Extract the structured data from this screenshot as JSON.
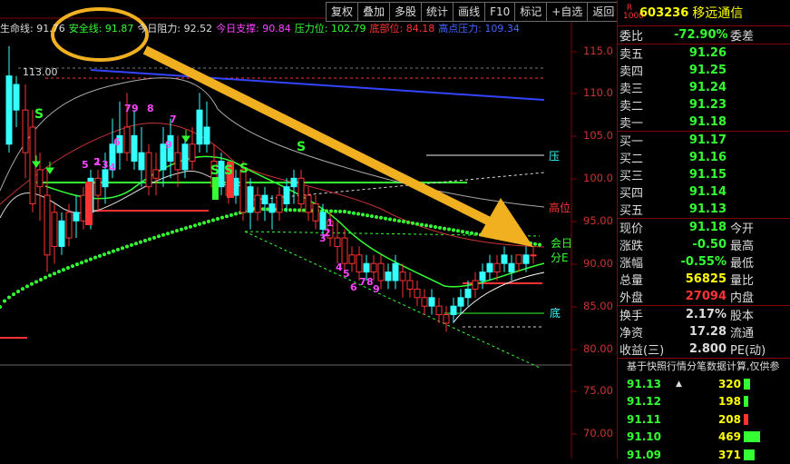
{
  "toolbar": [
    "复权",
    "叠加",
    "多股",
    "统计",
    "画线",
    "F10",
    "标记",
    "+自选",
    "返回"
  ],
  "indicators": [
    {
      "text": "生命线: 91.76",
      "color": "#dddddd"
    },
    {
      "text": "安全线: 91.87",
      "color": "#33ff33"
    },
    {
      "text": "今日阻力: 92.52",
      "color": "#dddddd"
    },
    {
      "text": "今日支撑: 90.84",
      "color": "#ff44ff"
    },
    {
      "text": "压力位: 102.79",
      "color": "#33ff33"
    },
    {
      "text": "底部位: 84.18",
      "color": "#ff3333"
    },
    {
      "text": "高点压力: 109.34",
      "color": "#4466ff"
    }
  ],
  "price_axis": [
    "115.0",
    "110.0",
    "105.0",
    "100.0",
    "95.00",
    "90.00",
    "85.00",
    "80.00",
    "75.00",
    "70.00"
  ],
  "chart_labels": {
    "high_marker": "113.00",
    "pressure": "压",
    "high_pos": "高位",
    "balance_1": "会日",
    "balance_2": "分E",
    "bottom": "底"
  },
  "chart_marks": [
    "S",
    "S",
    "S",
    "S",
    "S",
    "5",
    "6",
    "1",
    "2",
    "3",
    "4",
    "7",
    "9",
    "8",
    "7",
    "9",
    "3",
    "2",
    "1",
    "4",
    "5",
    "6",
    "7",
    "8",
    "9"
  ],
  "stock": {
    "logo": "R 1000",
    "code": "603236",
    "name": "移远通信"
  },
  "weibi": {
    "label": "委比",
    "value": "-72.90%",
    "label2": "委差"
  },
  "asks": [
    {
      "label": "卖五",
      "price": "91.26"
    },
    {
      "label": "卖四",
      "price": "91.25"
    },
    {
      "label": "卖三",
      "price": "91.24"
    },
    {
      "label": "卖二",
      "price": "91.23"
    },
    {
      "label": "卖一",
      "price": "91.18"
    }
  ],
  "bids": [
    {
      "label": "买一",
      "price": "91.17"
    },
    {
      "label": "买二",
      "price": "91.16"
    },
    {
      "label": "买三",
      "price": "91.15"
    },
    {
      "label": "买四",
      "price": "91.14"
    },
    {
      "label": "买五",
      "price": "91.13"
    }
  ],
  "quote": [
    {
      "label": "现价",
      "value": "91.18",
      "label2": "今开",
      "color": "#33ff33"
    },
    {
      "label": "涨跌",
      "value": "-0.50",
      "label2": "最高",
      "color": "#33ff33"
    },
    {
      "label": "涨幅",
      "value": "-0.55%",
      "label2": "最低",
      "color": "#33ff33"
    },
    {
      "label": "总量",
      "value": "56825",
      "label2": "量比",
      "color": "#ffff00"
    },
    {
      "label": "外盘",
      "value": "27094",
      "label2": "内盘",
      "color": "#ff3333"
    }
  ],
  "stats": [
    {
      "label": "换手",
      "value": "2.17%",
      "label2": "股本"
    },
    {
      "label": "净资",
      "value": "17.28",
      "label2": "流通"
    },
    {
      "label": "收益(三)",
      "value": "2.800",
      "label2": "PE(动)"
    }
  ],
  "note": "基于快照行情分笔数据计算,仅供参",
  "ticks": [
    {
      "price": "91.13",
      "arrow": "▲",
      "vol": "320",
      "bar": 0.12,
      "bar_color": "#33ff33"
    },
    {
      "price": "91.12",
      "arrow": "",
      "vol": "198",
      "bar": 0.08,
      "bar_color": "#33ff33"
    },
    {
      "price": "91.11",
      "arrow": "",
      "vol": "208",
      "bar": 0.08,
      "bar_color": "#ff3333"
    },
    {
      "price": "91.10",
      "arrow": "",
      "vol": "469",
      "bar": 0.3,
      "bar_color": "#33ff33"
    },
    {
      "price": "91.09",
      "arrow": "",
      "vol": "371",
      "bar": 0.2,
      "bar_color": "#33ff33"
    }
  ],
  "colors": {
    "up": "#ff3333",
    "down": "#33ffff",
    "accent_arrow": "#f0b020",
    "green": "#33ff33"
  }
}
